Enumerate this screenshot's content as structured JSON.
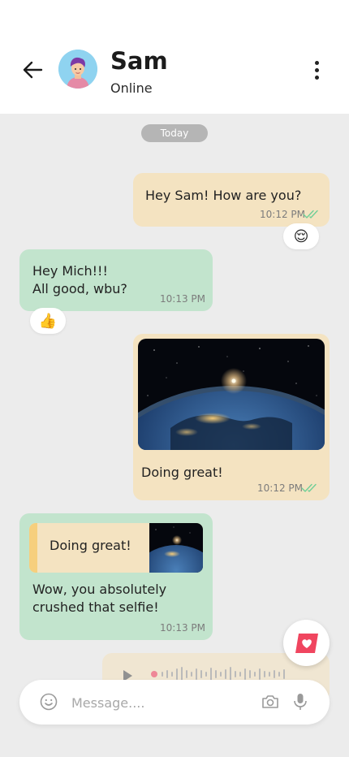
{
  "header": {
    "contact_name": "Sam",
    "status": "Online",
    "back_icon": "arrow-left-icon",
    "menu_icon": "more-vertical-icon"
  },
  "date_divider": "Today",
  "messages": [
    {
      "direction": "outgoing",
      "text": "Hey Sam! How are you?",
      "time": "10:12 PM",
      "read": true,
      "reaction": "😌"
    },
    {
      "direction": "incoming",
      "text": "Hey Mich!!!\nAll good, wbu?",
      "time": "10:13 PM",
      "reaction": "👍"
    },
    {
      "direction": "outgoing",
      "type": "image",
      "image_subject": "earth-from-space",
      "caption": "Doing great!",
      "time": "10:12 PM",
      "read": true
    },
    {
      "direction": "incoming",
      "quoted_text": "Doing great!",
      "text": "Wow, you absolutely\ncrushed that selfie!",
      "time": "10:13 PM"
    },
    {
      "direction": "outgoing",
      "type": "voice",
      "partially_hidden": true
    }
  ],
  "composer": {
    "placeholder": "Message....",
    "emoji_icon": "smiley-icon",
    "camera_icon": "camera-icon",
    "mic_icon": "microphone-icon"
  },
  "sticker_button_icon": "heart-sticker-icon",
  "colors": {
    "outgoing_bubble": "#f4e3c1",
    "incoming_bubble": "#c2e4cd",
    "read_ticks": "#6fcf97",
    "chat_background": "#ececec",
    "sticker_accent": "#f0455f"
  }
}
